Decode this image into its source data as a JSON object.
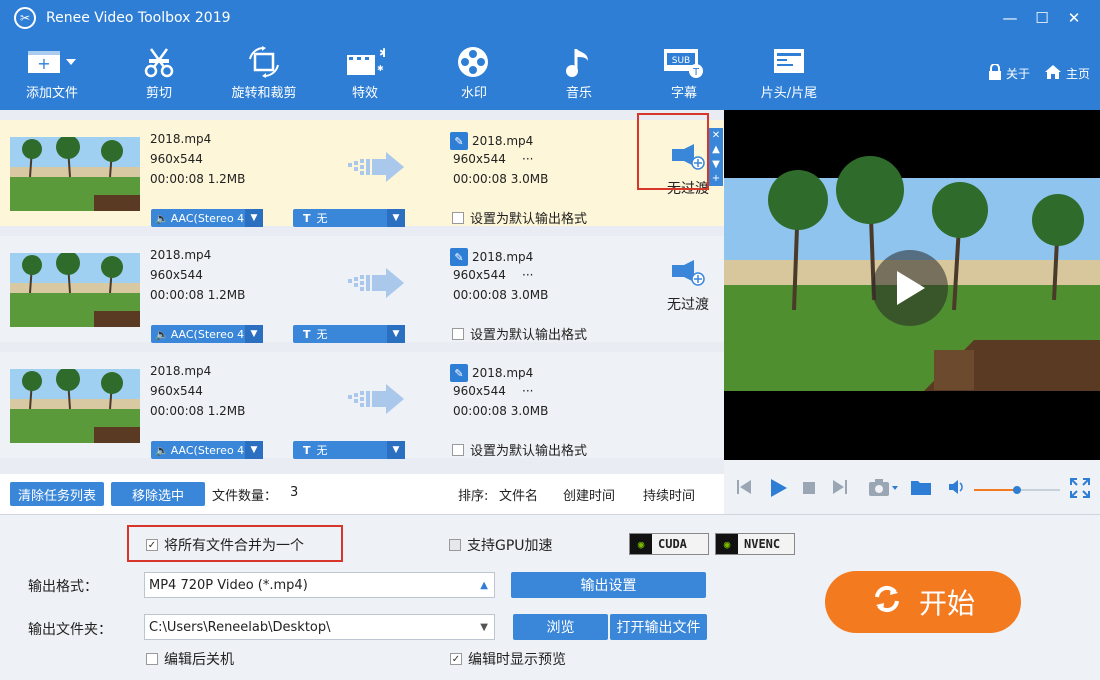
{
  "window": {
    "title": "Renee Video Toolbox 2019",
    "controls": [
      "—",
      "☐",
      "✕"
    ]
  },
  "toolbar": {
    "items": [
      {
        "label": "添加文件",
        "icon": "add-file-icon"
      },
      {
        "label": "剪切",
        "icon": "scissors-icon"
      },
      {
        "label": "旋转和裁剪",
        "icon": "rotate-crop-icon"
      },
      {
        "label": "特效",
        "icon": "effects-icon"
      },
      {
        "label": "水印",
        "icon": "watermark-icon"
      },
      {
        "label": "音乐",
        "icon": "music-icon"
      },
      {
        "label": "字幕",
        "icon": "subtitle-icon"
      },
      {
        "label": "片头/片尾",
        "icon": "intro-outro-icon"
      }
    ],
    "about": "关于",
    "home": "主页"
  },
  "files": [
    {
      "name": "2018.mp4",
      "res": "960x544",
      "info": "00:00:08  1.2MB",
      "out_name": "2018.mp4",
      "out_res": "960x544",
      "out_more": "···",
      "out_info": "00:00:08  3.0MB",
      "audio": "AAC(Stereo 4",
      "subtitle": "无",
      "default_label": "设置为默认输出格式",
      "transition": "无过渡"
    },
    {
      "name": "2018.mp4",
      "res": "960x544",
      "info": "00:00:08  1.2MB",
      "out_name": "2018.mp4",
      "out_res": "960x544",
      "out_more": "···",
      "out_info": "00:00:08  3.0MB",
      "audio": "AAC(Stereo 4",
      "subtitle": "无",
      "default_label": "设置为默认输出格式",
      "transition": "无过渡"
    },
    {
      "name": "2018.mp4",
      "res": "960x544",
      "info": "00:00:08  1.2MB",
      "out_name": "2018.mp4",
      "out_res": "960x544",
      "out_more": "···",
      "out_info": "00:00:08  3.0MB",
      "audio": "AAC(Stereo 4",
      "subtitle": "无",
      "default_label": "设置为默认输出格式"
    }
  ],
  "listbar": {
    "clear": "清除任务列表",
    "remove": "移除选中",
    "count_label": "文件数量：",
    "count": "3",
    "sort_label": "排序:",
    "sort_name": "文件名",
    "sort_created": "创建时间",
    "sort_duration": "持续时间"
  },
  "settings": {
    "merge_label": "将所有文件合并为一个",
    "merge_checked": true,
    "gpu_label": "支持GPU加速",
    "cuda": "CUDA",
    "nvenc": "NVENC",
    "format_label": "输出格式：",
    "format_value": "MP4 720P Video (*.mp4)",
    "output_settings": "输出设置",
    "folder_label": "输出文件夹：",
    "folder_value": "C:\\Users\\Reneelab\\Desktop\\",
    "browse": "浏览",
    "open_folder": "打开输出文件",
    "shutdown_label": "编辑后关机",
    "preview_label": "编辑时显示预览",
    "start": "开始"
  },
  "player": {
    "volume_level": 0.5
  },
  "colors": {
    "primary": "#2e7ed6",
    "button": "#3a87d9",
    "start": "#f47a20",
    "highlight_row": "#fdf6d8",
    "annotation": "#d9362b"
  }
}
